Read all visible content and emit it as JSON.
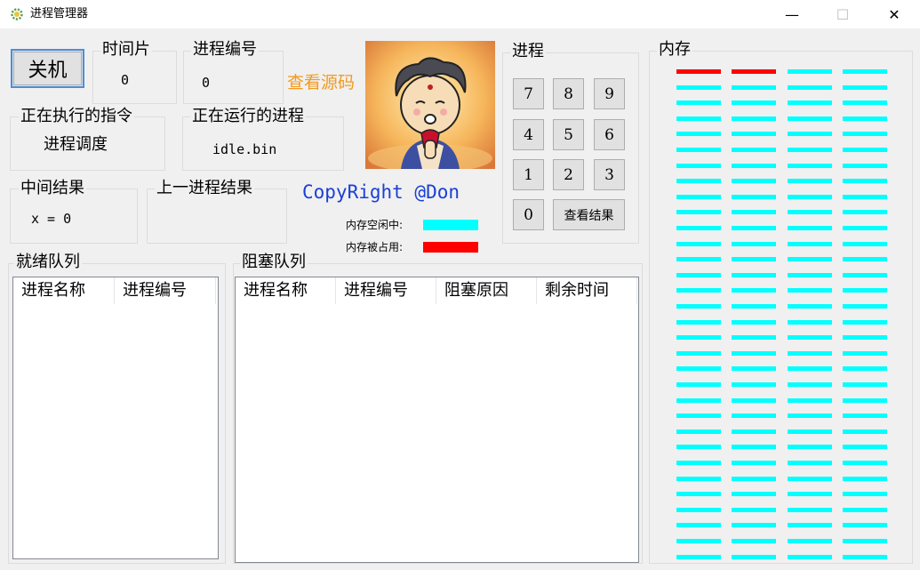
{
  "window": {
    "title": "进程管理器",
    "min_glyph": "—",
    "max_glyph": "☐",
    "close_glyph": "✕"
  },
  "buttons": {
    "shutdown": "关机",
    "view_result": "查看结果"
  },
  "time_slice": {
    "label": "时间片",
    "value": "0"
  },
  "process_id": {
    "label": "进程编号",
    "value": "0"
  },
  "view_source": "查看源码",
  "executing_instruction": {
    "label": "正在执行的指令",
    "value": "进程调度"
  },
  "running_process": {
    "label": "正在运行的进程",
    "value": "idle.bin"
  },
  "intermediate_result": {
    "label": "中间结果",
    "value": "x = 0"
  },
  "previous_result": {
    "label": "上一进程结果",
    "value": ""
  },
  "copyright": "CopyRight @Don",
  "memory_legend": {
    "free": "内存空闲中:",
    "occupied": "内存被占用:"
  },
  "keypad": {
    "label": "进程",
    "keys": [
      "7",
      "8",
      "9",
      "4",
      "5",
      "6",
      "1",
      "2",
      "3",
      "0"
    ]
  },
  "memory": {
    "label": "内存",
    "free_color": "#00ffff",
    "occupied_color": "#ff0000",
    "columns": 4,
    "rows": 32,
    "occupied_blocks": [
      0,
      1
    ]
  },
  "ready_queue": {
    "label": "就绪队列",
    "columns": [
      "进程名称",
      "进程编号"
    ],
    "rows": []
  },
  "blocked_queue": {
    "label": "阻塞队列",
    "columns": [
      "进程名称",
      "进程编号",
      "阻塞原因",
      "剩余时间"
    ],
    "rows": []
  }
}
